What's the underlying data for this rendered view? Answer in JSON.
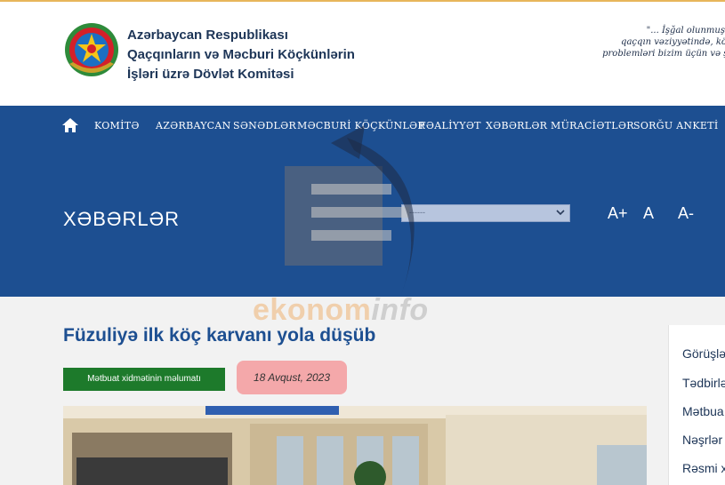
{
  "header": {
    "org_name_line1": "Azərbaycan Respublikası",
    "org_name_line2": "Qaçqınların və Məcburi Köçkünlərin",
    "org_name_line3": "İşləri üzrə Dövlət Komitəsi",
    "quote_line1": "\"... İşğal olunmuş  but",
    "quote_line2": "qaçqın  vəziyyətində,  köçkü",
    "quote_line3": "problemləri bizim üçün və şəxs"
  },
  "nav": {
    "items": [
      "KOMİTƏ",
      "AZƏRBAYCAN",
      "SƏNƏDLƏR",
      "MƏCBURİ KÖÇKÜNLƏR",
      "FƏALİYYƏT",
      "XƏBƏRLƏR",
      "MÜRACİƏTLƏR",
      "SORĞU ANKETİ"
    ]
  },
  "hero": {
    "title": "XƏBƏRLƏR",
    "select_value": "------",
    "font_increase": "A+",
    "font_reset": "A",
    "font_decrease": "A-"
  },
  "watermark": {
    "part1": "ekonom",
    "part2": "info"
  },
  "article": {
    "title": "Füzuliyə ilk köç karvanı yola düşüb",
    "category": "Mətbuat xidmətinin məlumatı",
    "date": "18 Avqust, 2023"
  },
  "sidebar": {
    "items": [
      "Görüşlə",
      "Tədbirlə",
      "Mətbua",
      "Nəşrlər",
      "Rəsmi x"
    ]
  },
  "colors": {
    "navy": "#1d4f91",
    "title_blue": "#1d4f91",
    "category_green": "#1d7a2b",
    "date_pink": "#f4a8aa"
  }
}
